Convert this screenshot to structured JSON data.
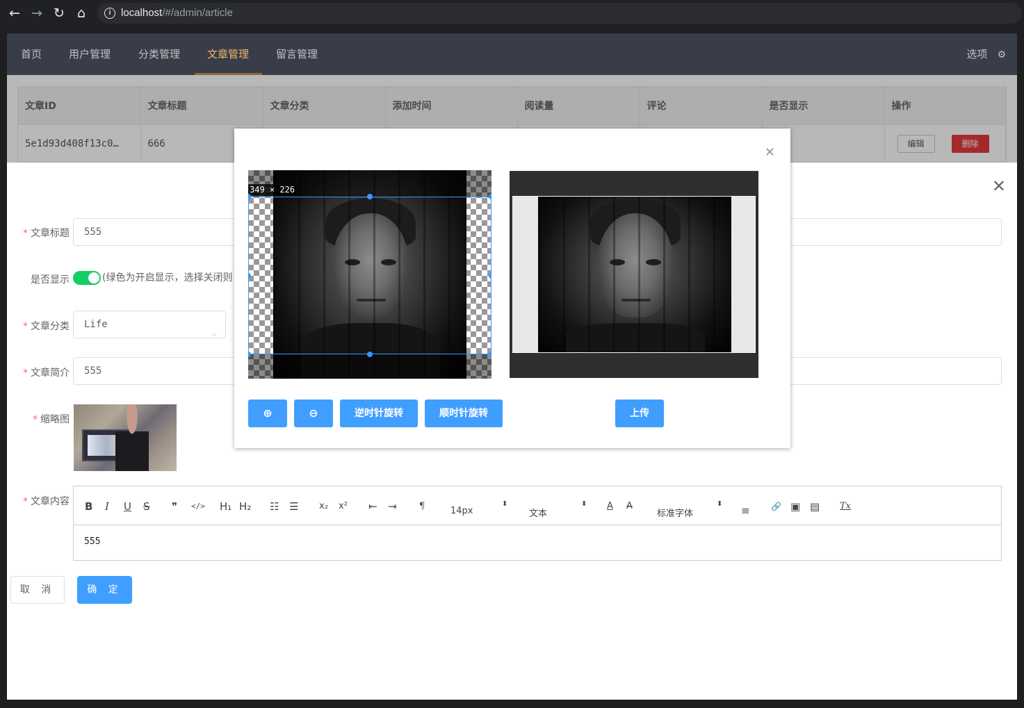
{
  "browser": {
    "url_host": "localhost",
    "url_path": "/#/admin/article",
    "back_icon": "←",
    "forward_icon": "→",
    "reload_icon": "↻",
    "home_icon": "⌂",
    "info_icon": "i"
  },
  "topnav": {
    "items": [
      "首页",
      "用户管理",
      "分类管理",
      "文章管理",
      "留言管理"
    ],
    "active_index": 3,
    "settings_label": "选项",
    "settings_icon": "⚙"
  },
  "table": {
    "headers": [
      "文章ID",
      "文章标题",
      "文章分类",
      "添加时间",
      "阅读量",
      "评论",
      "是否显示",
      "操作"
    ],
    "row": {
      "id": "5e1d93d408f13c0…",
      "title": "666",
      "edit_label": "编辑",
      "delete_label": "删除"
    }
  },
  "form": {
    "close_icon": "✕",
    "title_label": "文章标题",
    "title_value": "555",
    "show_label": "是否显示",
    "show_enabled": true,
    "show_hint": "(绿色为开启显示，选择关闭则",
    "category_label": "文章分类",
    "category_value": "Life",
    "category_arrow": "⌵",
    "intro_label": "文章简介",
    "intro_value": "555",
    "thumb_label": "缩略图",
    "content_label": "文章内容",
    "content_value": "555",
    "cancel_label": "取 消",
    "ok_label": "确 定",
    "required_mark": "*"
  },
  "editor_toolbar": {
    "bold": "B",
    "italic": "I",
    "underline": "U",
    "strike": "S",
    "quote": "❞",
    "code": "</>",
    "h1": "H₁",
    "h2": "H₂",
    "ordered_list": "☷",
    "bullet_list": "☰",
    "subscript": "x₂",
    "superscript": "x²",
    "outdent": "⇤",
    "indent": "⇥",
    "direction": "¶",
    "size_select": "14px",
    "header_select": "文本",
    "font_select": "标准字体",
    "color": "A",
    "background": "A",
    "align": "≡",
    "link": "🔗",
    "image": "▣",
    "video": "▤",
    "clean": "Tx",
    "caret": "⬍"
  },
  "cropper": {
    "close_icon": "✕",
    "crop_info": "349 × 226",
    "zoom_in_icon": "⊕",
    "zoom_out_icon": "⊖",
    "rotate_left_label": "逆时针旋转",
    "rotate_right_label": "顺时针旋转",
    "upload_label": "上传",
    "accent_color": "#409eff"
  }
}
